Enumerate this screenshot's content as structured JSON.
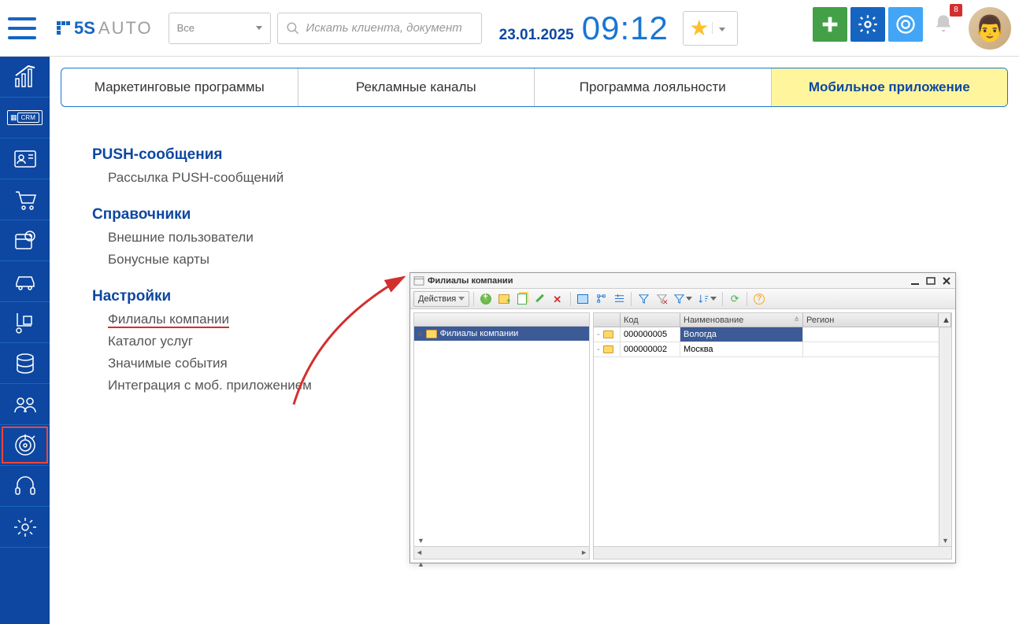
{
  "header": {
    "logo_5s": "5S",
    "logo_auto": "AUTO",
    "filter_label": "Все",
    "search_placeholder": "Искать клиента, документ",
    "date": "23.01.2025",
    "time": "09:12",
    "notification_count": "8"
  },
  "tabs": [
    {
      "label": "Маркетинговые программы"
    },
    {
      "label": "Рекламные каналы"
    },
    {
      "label": "Программа лояльности"
    },
    {
      "label": "Мобильное приложение",
      "active": true
    }
  ],
  "sections": {
    "push": {
      "title": "PUSH-сообщения",
      "items": [
        "Рассылка PUSH-сообщений"
      ]
    },
    "refs": {
      "title": "Справочники",
      "items": [
        "Внешние пользователи",
        "Бонусные карты"
      ]
    },
    "settings": {
      "title": "Настройки",
      "items": [
        "Филиалы компании",
        "Каталог услуг",
        "Значимые события",
        "Интеграция с моб. приложением"
      ]
    }
  },
  "onec": {
    "title": "Филиалы компании",
    "actions_label": "Действия",
    "tree_root": "Филиалы компании",
    "columns": {
      "code": "Код",
      "name": "Наименование",
      "region": "Регион"
    },
    "rows": [
      {
        "code": "000000005",
        "name": "Вологда",
        "selected": true
      },
      {
        "code": "000000002",
        "name": "Москва"
      }
    ]
  },
  "sidebar_icons": [
    "chart",
    "crm",
    "contact",
    "cart",
    "calendar",
    "car",
    "dolly",
    "database",
    "group",
    "target",
    "headset",
    "gear"
  ]
}
